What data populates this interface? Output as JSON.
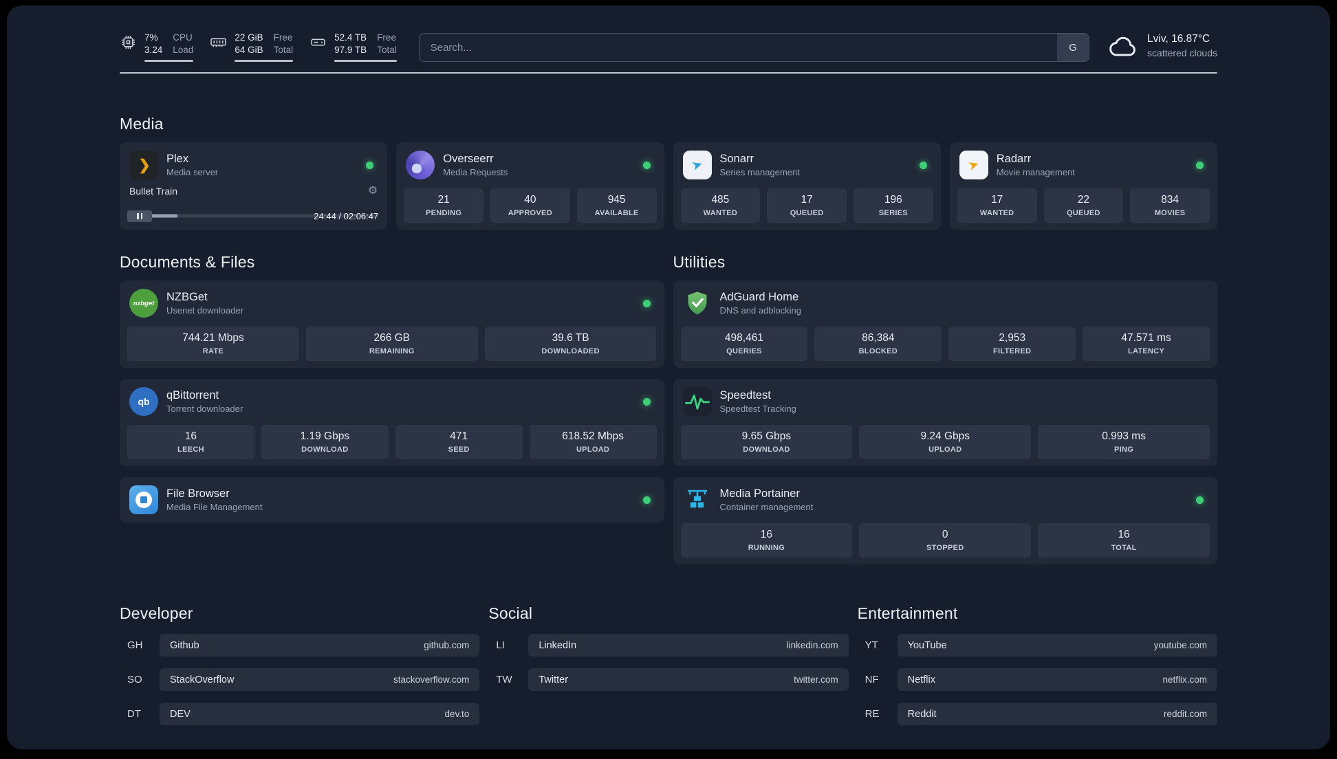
{
  "colors": {
    "page_bg": "#161d2c",
    "card_bg": "#212938",
    "status_online": "#3ecf76",
    "plex_amber": "#e8a10e"
  },
  "icons": {
    "plex_glyph": "❯",
    "gear": "⚙",
    "sonarr_arrow": "➤",
    "radarr_arrow": "➤",
    "nzbget_text": "nzbget",
    "qbittorrent_text": "qb"
  },
  "topbar": {
    "cpu": {
      "value_top": "7%",
      "value_bottom": "3.24",
      "label_top": "CPU",
      "label_bottom": "Load"
    },
    "memory": {
      "value_top": "22 GiB",
      "value_bottom": "64 GiB",
      "label_top": "Free",
      "label_bottom": "Total"
    },
    "disk": {
      "value_top": "52.4 TB",
      "value_bottom": "97.9 TB",
      "label_top": "Free",
      "label_bottom": "Total"
    },
    "search": {
      "placeholder": "Search...",
      "provider_button": "G"
    },
    "weather": {
      "location": "Lviv, 16.87°C",
      "condition": "scattered clouds"
    }
  },
  "sections": {
    "media": {
      "title": "Media"
    },
    "documents": {
      "title": "Documents & Files"
    },
    "utilities": {
      "title": "Utilities"
    }
  },
  "apps": {
    "plex": {
      "name": "Plex",
      "subtitle": "Media server",
      "now_playing": "Bullet Train",
      "time": "24:44 / 02:06:47"
    },
    "overseerr": {
      "name": "Overseerr",
      "subtitle": "Media Requests",
      "stats": [
        {
          "value": "21",
          "label": "PENDING"
        },
        {
          "value": "40",
          "label": "APPROVED"
        },
        {
          "value": "945",
          "label": "AVAILABLE"
        }
      ]
    },
    "sonarr": {
      "name": "Sonarr",
      "subtitle": "Series management",
      "stats": [
        {
          "value": "485",
          "label": "WANTED"
        },
        {
          "value": "17",
          "label": "QUEUED"
        },
        {
          "value": "196",
          "label": "SERIES"
        }
      ]
    },
    "radarr": {
      "name": "Radarr",
      "subtitle": "Movie management",
      "stats": [
        {
          "value": "17",
          "label": "WANTED"
        },
        {
          "value": "22",
          "label": "QUEUED"
        },
        {
          "value": "834",
          "label": "MOVIES"
        }
      ]
    },
    "nzbget": {
      "name": "NZBGet",
      "subtitle": "Usenet downloader",
      "stats": [
        {
          "value": "744.21 Mbps",
          "label": "RATE"
        },
        {
          "value": "266 GB",
          "label": "REMAINING"
        },
        {
          "value": "39.6 TB",
          "label": "DOWNLOADED"
        }
      ]
    },
    "qbittorrent": {
      "name": "qBittorrent",
      "subtitle": "Torrent downloader",
      "stats": [
        {
          "value": "16",
          "label": "LEECH"
        },
        {
          "value": "1.19 Gbps",
          "label": "DOWNLOAD"
        },
        {
          "value": "471",
          "label": "SEED"
        },
        {
          "value": "618.52 Mbps",
          "label": "UPLOAD"
        }
      ]
    },
    "filebrowser": {
      "name": "File Browser",
      "subtitle": "Media File Management"
    },
    "adguard": {
      "name": "AdGuard Home",
      "subtitle": "DNS and adblocking",
      "stats": [
        {
          "value": "498,461",
          "label": "QUERIES"
        },
        {
          "value": "86,384",
          "label": "BLOCKED"
        },
        {
          "value": "2,953",
          "label": "FILTERED"
        },
        {
          "value": "47.571 ms",
          "label": "LATENCY"
        }
      ]
    },
    "speedtest": {
      "name": "Speedtest",
      "subtitle": "Speedtest Tracking",
      "stats": [
        {
          "value": "9.65 Gbps",
          "label": "DOWNLOAD"
        },
        {
          "value": "9.24 Gbps",
          "label": "UPLOAD"
        },
        {
          "value": "0.993 ms",
          "label": "PING"
        }
      ]
    },
    "portainer": {
      "name": "Media Portainer",
      "subtitle": "Container management",
      "stats": [
        {
          "value": "16",
          "label": "RUNNING"
        },
        {
          "value": "0",
          "label": "STOPPED"
        },
        {
          "value": "16",
          "label": "TOTAL"
        }
      ]
    }
  },
  "bookmarks": [
    {
      "title": "Developer",
      "items": [
        {
          "abbr": "GH",
          "name": "Github",
          "url": "github.com"
        },
        {
          "abbr": "SO",
          "name": "StackOverflow",
          "url": "stackoverflow.com"
        },
        {
          "abbr": "DT",
          "name": "DEV",
          "url": "dev.to"
        }
      ]
    },
    {
      "title": "Social",
      "items": [
        {
          "abbr": "LI",
          "name": "LinkedIn",
          "url": "linkedin.com"
        },
        {
          "abbr": "TW",
          "name": "Twitter",
          "url": "twitter.com"
        }
      ]
    },
    {
      "title": "Entertainment",
      "items": [
        {
          "abbr": "YT",
          "name": "YouTube",
          "url": "youtube.com"
        },
        {
          "abbr": "NF",
          "name": "Netflix",
          "url": "netflix.com"
        },
        {
          "abbr": "RE",
          "name": "Reddit",
          "url": "reddit.com"
        }
      ]
    }
  ]
}
